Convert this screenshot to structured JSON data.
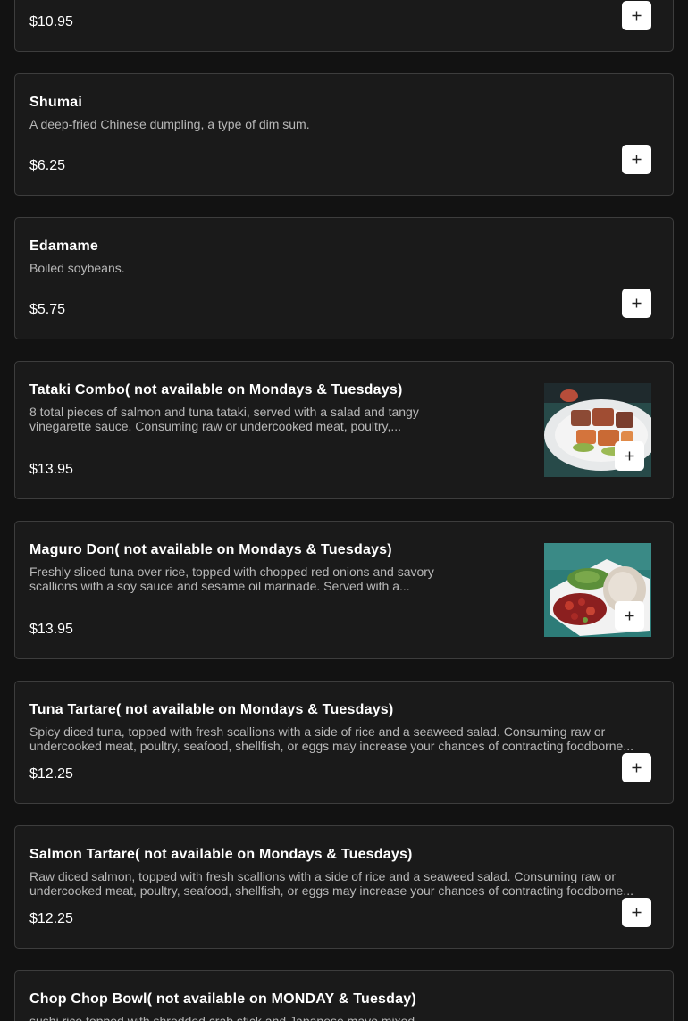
{
  "menu": {
    "items": [
      {
        "name": "",
        "description": "",
        "price": "$10.95",
        "has_image": false
      },
      {
        "name": "Shumai",
        "description": "A deep-fried Chinese dumpling, a type of dim sum.",
        "price": "$6.25",
        "has_image": false
      },
      {
        "name": "Edamame",
        "description": "Boiled soybeans.",
        "price": "$5.75",
        "has_image": false
      },
      {
        "name": "Tataki Combo( not available on Mondays & Tuesdays)",
        "description": "8 total pieces of salmon and tuna tataki, served with a salad and tangy vinegarette sauce. Consuming raw or undercooked meat, poultry,...",
        "price": "$13.95",
        "has_image": true,
        "image_icon": "salmon-tuna-tataki-photo"
      },
      {
        "name": "Maguro Don( not available on Mondays & Tuesdays)",
        "description": "Freshly sliced tuna over rice, topped with chopped red onions and savory scallions with a soy sauce and sesame oil marinade. Served with a...",
        "price": "$13.95",
        "has_image": true,
        "image_icon": "tuna-rice-bowl-photo"
      },
      {
        "name": "Tuna Tartare( not available on Mondays & Tuesdays)",
        "description": "Spicy diced tuna, topped with fresh scallions with a side of rice and a seaweed salad. Consuming raw or undercooked meat, poultry, seafood, shellfish, or eggs may increase your chances of contracting foodborne...",
        "price": "$12.25",
        "has_image": false
      },
      {
        "name": "Salmon Tartare( not available on Mondays & Tuesdays)",
        "description": "Raw diced salmon, topped with fresh scallions with a side of rice and a seaweed salad. Consuming raw or undercooked meat, poultry, seafood, shellfish, or eggs may increase your chances of contracting foodborne...",
        "price": "$12.25",
        "has_image": false
      },
      {
        "name": "Chop Chop Bowl( not available on MONDAY & Tuesday)",
        "description": "sushi rice topped with shredded crab stick and Japanese mayo mixed",
        "price": "",
        "has_image": false
      }
    ],
    "add_icon": "plus-icon"
  },
  "colors": {
    "background": "#121212",
    "card": "#1a1a1a",
    "border": "#3d3d3d",
    "text": "#ffffff",
    "muted_text": "#b8b8b8",
    "button": "#ffffff"
  }
}
